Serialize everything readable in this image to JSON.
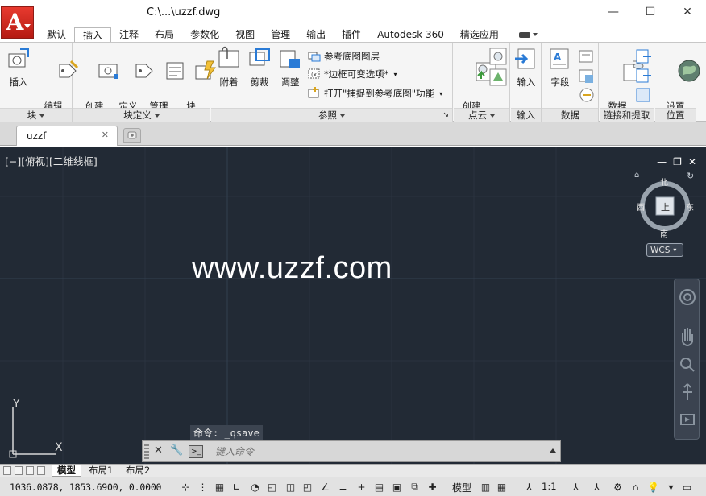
{
  "window": {
    "title": "C:\\...\\uzzf.dwg",
    "minimize": "—",
    "maximize": "☐",
    "close": "✕",
    "logo_letter": "A"
  },
  "ribbon_tabs": [
    "默认",
    "插入",
    "注释",
    "布局",
    "参数化",
    "视图",
    "管理",
    "输出",
    "插件",
    "Autodesk 360",
    "精选应用"
  ],
  "active_tab": "插入",
  "panels": {
    "block": {
      "title": "块",
      "tools": [
        {
          "label": "插入"
        },
        {
          "label": "编辑\n属性"
        }
      ]
    },
    "block_def": {
      "title": "块定义",
      "tools": [
        {
          "label": "创建\n块"
        },
        {
          "label": "定义\n属性"
        },
        {
          "label": "管理\n属性"
        },
        {
          "label": "块\n编辑器"
        }
      ]
    },
    "reference": {
      "title": "参照",
      "tools": [
        {
          "label": "附着"
        },
        {
          "label": "剪裁"
        },
        {
          "label": "调整"
        }
      ],
      "small": [
        "参考底图图层",
        "*边框可变选项*",
        "打开\"捕捉到参考底图\"功能"
      ]
    },
    "pointcloud": {
      "title": "点云",
      "tools": [
        {
          "label": "创建\n点云"
        }
      ]
    },
    "import": {
      "title": "输入",
      "tools": [
        {
          "label": "输入"
        }
      ]
    },
    "data": {
      "title": "数据",
      "tools": [
        {
          "label": "字段"
        }
      ]
    },
    "link": {
      "title": "链接和提取",
      "tools": [
        {
          "label": "数据\n链接"
        }
      ]
    },
    "location": {
      "title": "位置",
      "tools": [
        {
          "label": "设置\n位置"
        }
      ]
    }
  },
  "file_tab": {
    "name": "uzzf",
    "close": "✕"
  },
  "viewport": {
    "label": "[−][俯视][二维线框]",
    "watermark": "www.uzzf.com",
    "controls": [
      "—",
      "❐",
      "✕"
    ]
  },
  "viewcube": {
    "north": "北",
    "south": "南",
    "east": "东",
    "west": "西",
    "face": "上",
    "wcs": "WCS"
  },
  "command": {
    "history": "命令: _qsave",
    "placeholder": "键入命令"
  },
  "layout_tabs": [
    "模型",
    "布局1",
    "布局2"
  ],
  "active_layout": "模型",
  "status": {
    "coords": "1036.0878, 1853.6900, 0.0000",
    "model": "模型",
    "scale": "1:1"
  },
  "colors": {
    "canvas_bg": "#222a35",
    "logo_red": "#d42a1f",
    "ribbon_bg": "#f5f5f5"
  }
}
